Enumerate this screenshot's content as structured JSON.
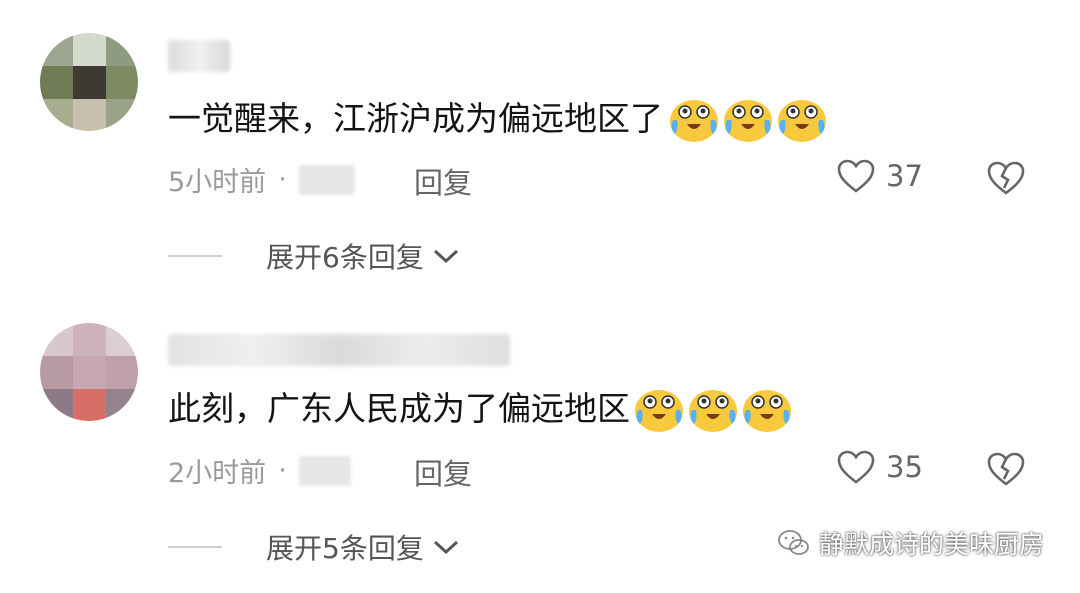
{
  "comments": [
    {
      "text": "一觉醒来，江浙沪成为偏远地区了",
      "time": "5小时前",
      "separator": "·",
      "reply_label": "回复",
      "likes": "37",
      "expand_label": "展开6条回复",
      "emoji_count": 3
    },
    {
      "text": "此刻，广东人民成为了偏远地区",
      "time": "2小时前",
      "separator": "·",
      "reply_label": "回复",
      "likes": "35",
      "expand_label": "展开5条回复",
      "emoji_count": 3
    }
  ],
  "watermark": {
    "text": "静默成诗的美味厨房"
  },
  "colors": {
    "emoji_yellow": "#f8c93c",
    "tear_blue": "#5ab0ee",
    "muted_text": "#9a9a9a"
  }
}
